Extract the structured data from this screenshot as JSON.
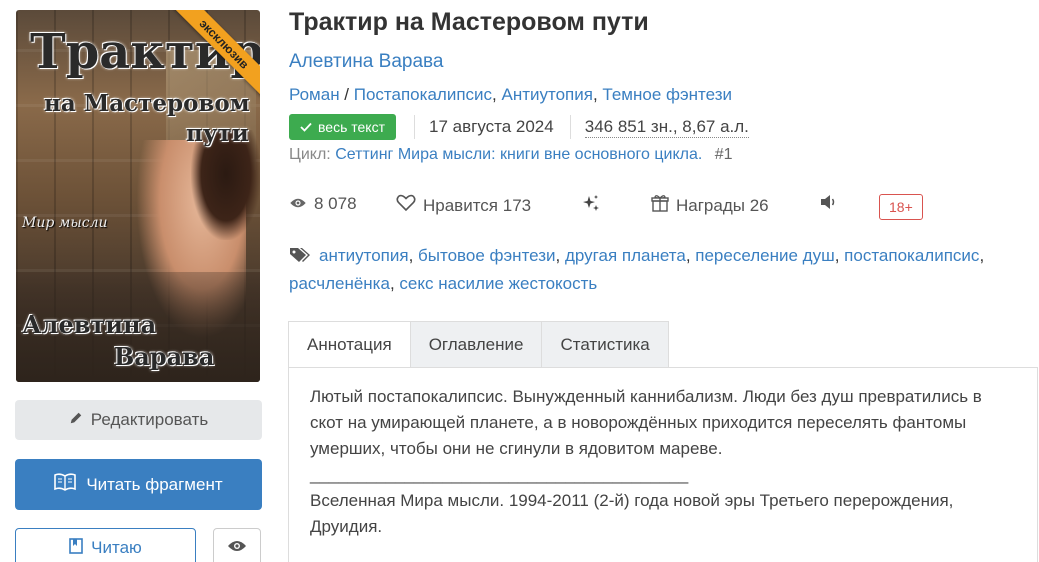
{
  "cover": {
    "title_line1": "Трактир",
    "title_line2": "на Мастеровом",
    "title_line3": "пути",
    "series_line": "Мир мысли",
    "author_line1": "Алевтина",
    "author_line2": "Варава",
    "ribbon": "эксклюзив"
  },
  "buttons": {
    "edit": "Редактировать",
    "read_fragment": "Читать фрагмент",
    "reading": "Читаю"
  },
  "book": {
    "title": "Трактир на Мастеровом пути",
    "author": "Алевтина Варава",
    "genre_main": "Роман",
    "genre_sep": " / ",
    "genres": [
      "Постапокалипсис",
      "Антиутопия",
      "Темное фэнтези"
    ],
    "badge": "весь текст",
    "date": "17 августа 2024",
    "size": "346 851 зн., 8,67 а.л.",
    "cycle_label": "Цикл:",
    "cycle_name": "Сеттинг Мира мысли: книги вне основного цикла.",
    "cycle_num": "#1"
  },
  "stats": {
    "views": "8 078",
    "likes": "Нравится 173",
    "awards": "Награды 26",
    "age": "18+"
  },
  "tags": [
    "антиутопия",
    "бытовое фэнтези",
    "другая планета",
    "переселение душ",
    "постапокалипсис",
    "расчленёнка",
    "секс насилие жестокость"
  ],
  "tabs": [
    "Аннотация",
    "Оглавление",
    "Статистика"
  ],
  "annotation": {
    "p1": "Лютый постапокалипсис. Вынужденный каннибализм. Люди без душ превратились в скот на умирающей планете, а в новорождённых приходится переселять фантомы умерших, чтобы они не сгинули в ядовитом мареве.",
    "rule": "________________________________________",
    "p2": "Вселенная Мира мысли. 1994-2011 (2-й) года новой эры Третьего перерождения, Друидия."
  },
  "colors": {
    "accent": "#3a7fc1",
    "badge_green": "#3dab4f",
    "age_red": "#d9534f",
    "ribbon": "#f2a11f"
  }
}
